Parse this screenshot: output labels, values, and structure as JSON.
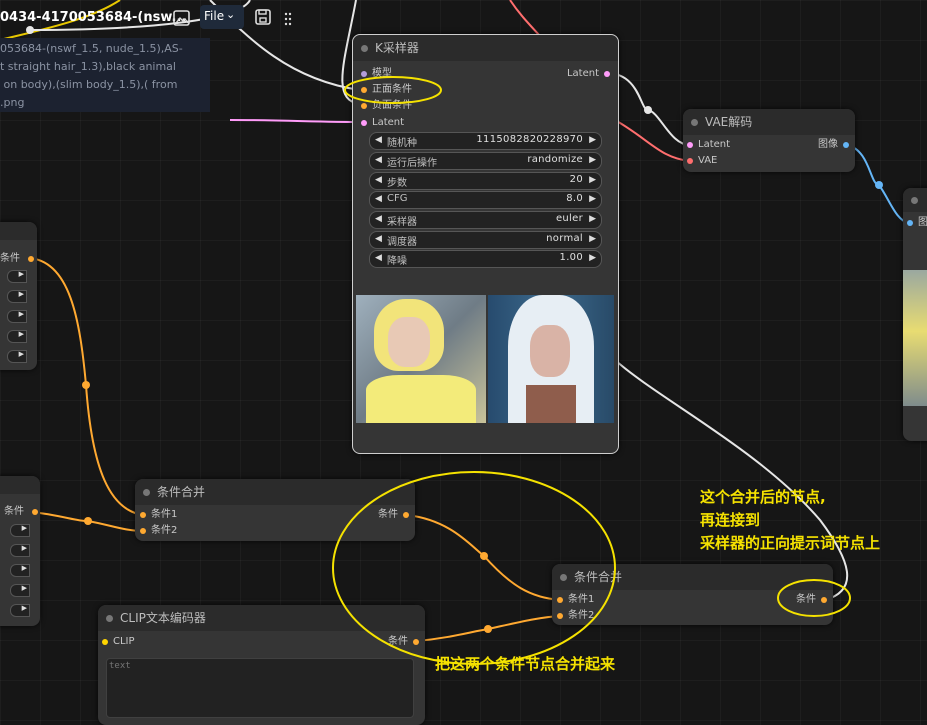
{
  "toolbar": {
    "workflow_name": "0434-4170053684-(nsw...",
    "file_menu": "File",
    "image_icon": "image-icon",
    "save_icon": "save-icon",
    "more_icon": "more-dots-icon"
  },
  "prompt_preview": {
    "lines": [
      "053684-(nswf_1.5, nude_1.5),AS-",
      "t straight hair_1.3),black animal",
      " on body),(slim body_1.5),( from",
      ".png"
    ]
  },
  "ksampler": {
    "title": "K采样器",
    "inputs": [
      "模型",
      "正面条件",
      "负面条件",
      "Latent"
    ],
    "output": "Latent",
    "widgets": [
      {
        "label": "随机种",
        "value": "1115082820228970"
      },
      {
        "label": "运行后操作",
        "value": "randomize"
      },
      {
        "label": "步数",
        "value": "20"
      },
      {
        "label": "CFG",
        "value": "8.0"
      },
      {
        "label": "采样器",
        "value": "euler"
      },
      {
        "label": "调度器",
        "value": "normal"
      },
      {
        "label": "降噪",
        "value": "1.00"
      }
    ]
  },
  "vae_decode": {
    "title": "VAE解码",
    "inputs": [
      "Latent",
      "VAE"
    ],
    "output": "图像"
  },
  "right_node_partial": {
    "input_label": "图"
  },
  "left_node_top": {
    "output": "条件"
  },
  "left_node_bottom": {
    "output": "条件"
  },
  "cond_combine_1": {
    "title": "条件合并",
    "inputs": [
      "条件1",
      "条件2"
    ],
    "output": "条件"
  },
  "cond_combine_2": {
    "title": "条件合并",
    "inputs": [
      "条件1",
      "条件2"
    ],
    "output": "条件"
  },
  "clip_encode": {
    "title": "CLIP文本编码器",
    "input": "CLIP",
    "output": "条件",
    "text_placeholder": "text"
  },
  "annotations": {
    "right_note": [
      "这个合并后的节点,",
      "再连接到",
      "采样器的正向提示词节点上"
    ],
    "bottom_note": "把这两个条件节点合并起来"
  },
  "colors": {
    "conditioning": "#ffa931",
    "latent": "#ff9cf9",
    "vae": "#ff6e6e",
    "image": "#64b5f6",
    "clip": "#ffd500",
    "model": "#b39ddb",
    "annotation": "#f5e200"
  }
}
